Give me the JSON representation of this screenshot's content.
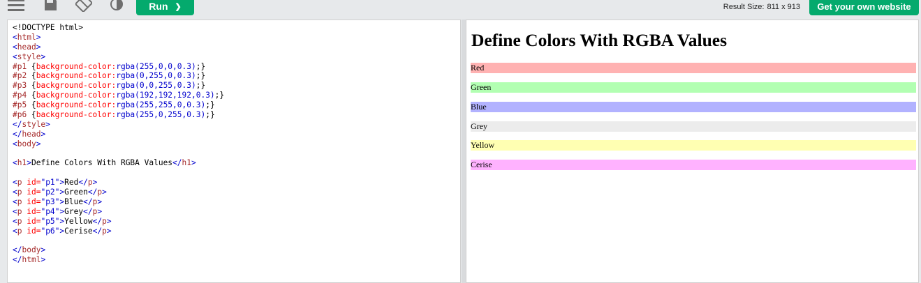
{
  "toolbar": {
    "run_label": "Run",
    "run_chevron": "❯",
    "result_size_label": "Result Size:",
    "result_size_value": "811 x 913",
    "get_site_label": "Get your own website"
  },
  "icons": {
    "menu": "menu-icon",
    "save": "save-icon",
    "orientation": "rotate-icon",
    "theme": "contrast-icon"
  },
  "editor": {
    "lines": [
      [
        [
          "t-doc",
          "<!DOCTYPE html>"
        ]
      ],
      [
        [
          "t-br",
          "<"
        ],
        [
          "t-tag",
          "html"
        ],
        [
          "t-br",
          ">"
        ]
      ],
      [
        [
          "t-br",
          "<"
        ],
        [
          "t-tag",
          "head"
        ],
        [
          "t-br",
          ">"
        ]
      ],
      [
        [
          "t-br",
          "<"
        ],
        [
          "t-tag",
          "style"
        ],
        [
          "t-br",
          ">"
        ]
      ],
      [
        [
          "t-sel",
          "#p1 "
        ],
        [
          "t-txt",
          "{"
        ],
        [
          "t-prop",
          "background-color:"
        ],
        [
          "t-val",
          "rgba(255,0,0,0.3)"
        ],
        [
          "t-txt",
          ";}"
        ]
      ],
      [
        [
          "t-sel",
          "#p2 "
        ],
        [
          "t-txt",
          "{"
        ],
        [
          "t-prop",
          "background-color:"
        ],
        [
          "t-val",
          "rgba(0,255,0,0.3)"
        ],
        [
          "t-txt",
          ";}"
        ]
      ],
      [
        [
          "t-sel",
          "#p3 "
        ],
        [
          "t-txt",
          "{"
        ],
        [
          "t-prop",
          "background-color:"
        ],
        [
          "t-val",
          "rgba(0,0,255,0.3)"
        ],
        [
          "t-txt",
          ";}"
        ]
      ],
      [
        [
          "t-sel",
          "#p4 "
        ],
        [
          "t-txt",
          "{"
        ],
        [
          "t-prop",
          "background-color:"
        ],
        [
          "t-val",
          "rgba(192,192,192,0.3)"
        ],
        [
          "t-txt",
          ";}"
        ]
      ],
      [
        [
          "t-sel",
          "#p5 "
        ],
        [
          "t-txt",
          "{"
        ],
        [
          "t-prop",
          "background-color:"
        ],
        [
          "t-val",
          "rgba(255,255,0,0.3)"
        ],
        [
          "t-txt",
          ";}"
        ]
      ],
      [
        [
          "t-sel",
          "#p6 "
        ],
        [
          "t-txt",
          "{"
        ],
        [
          "t-prop",
          "background-color:"
        ],
        [
          "t-val",
          "rgba(255,0,255,0.3)"
        ],
        [
          "t-txt",
          ";}"
        ]
      ],
      [
        [
          "t-br",
          "</"
        ],
        [
          "t-tag",
          "style"
        ],
        [
          "t-br",
          ">"
        ]
      ],
      [
        [
          "t-br",
          "</"
        ],
        [
          "t-tag",
          "head"
        ],
        [
          "t-br",
          ">"
        ]
      ],
      [
        [
          "t-br",
          "<"
        ],
        [
          "t-tag",
          "body"
        ],
        [
          "t-br",
          ">"
        ]
      ],
      [],
      [
        [
          "t-br",
          "<"
        ],
        [
          "t-tag",
          "h1"
        ],
        [
          "t-br",
          ">"
        ],
        [
          "t-txt",
          "Define Colors With RGBA Values"
        ],
        [
          "t-br",
          "</"
        ],
        [
          "t-tag",
          "h1"
        ],
        [
          "t-br",
          ">"
        ]
      ],
      [],
      [
        [
          "t-br",
          "<"
        ],
        [
          "t-tag",
          "p"
        ],
        [
          "t-attr",
          " id="
        ],
        [
          "t-str",
          "\"p1\""
        ],
        [
          "t-br",
          ">"
        ],
        [
          "t-txt",
          "Red"
        ],
        [
          "t-br",
          "</"
        ],
        [
          "t-tag",
          "p"
        ],
        [
          "t-br",
          ">"
        ]
      ],
      [
        [
          "t-br",
          "<"
        ],
        [
          "t-tag",
          "p"
        ],
        [
          "t-attr",
          " id="
        ],
        [
          "t-str",
          "\"p2\""
        ],
        [
          "t-br",
          ">"
        ],
        [
          "t-txt",
          "Green"
        ],
        [
          "t-br",
          "</"
        ],
        [
          "t-tag",
          "p"
        ],
        [
          "t-br",
          ">"
        ]
      ],
      [
        [
          "t-br",
          "<"
        ],
        [
          "t-tag",
          "p"
        ],
        [
          "t-attr",
          " id="
        ],
        [
          "t-str",
          "\"p3\""
        ],
        [
          "t-br",
          ">"
        ],
        [
          "t-txt",
          "Blue"
        ],
        [
          "t-br",
          "</"
        ],
        [
          "t-tag",
          "p"
        ],
        [
          "t-br",
          ">"
        ]
      ],
      [
        [
          "t-br",
          "<"
        ],
        [
          "t-tag",
          "p"
        ],
        [
          "t-attr",
          " id="
        ],
        [
          "t-str",
          "\"p4\""
        ],
        [
          "t-br",
          ">"
        ],
        [
          "t-txt",
          "Grey"
        ],
        [
          "t-br",
          "</"
        ],
        [
          "t-tag",
          "p"
        ],
        [
          "t-br",
          ">"
        ]
      ],
      [
        [
          "t-br",
          "<"
        ],
        [
          "t-tag",
          "p"
        ],
        [
          "t-attr",
          " id="
        ],
        [
          "t-str",
          "\"p5\""
        ],
        [
          "t-br",
          ">"
        ],
        [
          "t-txt",
          "Yellow"
        ],
        [
          "t-br",
          "</"
        ],
        [
          "t-tag",
          "p"
        ],
        [
          "t-br",
          ">"
        ]
      ],
      [
        [
          "t-br",
          "<"
        ],
        [
          "t-tag",
          "p"
        ],
        [
          "t-attr",
          " id="
        ],
        [
          "t-str",
          "\"p6\""
        ],
        [
          "t-br",
          ">"
        ],
        [
          "t-txt",
          "Cerise"
        ],
        [
          "t-br",
          "</"
        ],
        [
          "t-tag",
          "p"
        ],
        [
          "t-br",
          ">"
        ]
      ],
      [],
      [
        [
          "t-br",
          "</"
        ],
        [
          "t-tag",
          "body"
        ],
        [
          "t-br",
          ">"
        ]
      ],
      [
        [
          "t-br",
          "</"
        ],
        [
          "t-tag",
          "html"
        ],
        [
          "t-br",
          ">"
        ]
      ]
    ]
  },
  "result": {
    "heading": "Define Colors With RGBA Values",
    "paragraphs": [
      {
        "label": "Red",
        "color": "rgba(255,0,0,0.3)"
      },
      {
        "label": "Green",
        "color": "rgba(0,255,0,0.3)"
      },
      {
        "label": "Blue",
        "color": "rgba(0,0,255,0.3)"
      },
      {
        "label": "Grey",
        "color": "rgba(192,192,192,0.3)"
      },
      {
        "label": "Yellow",
        "color": "rgba(255,255,0,0.3)"
      },
      {
        "label": "Cerise",
        "color": "rgba(255,0,255,0.3)"
      }
    ]
  },
  "colors": {
    "accent": "#04aa6d",
    "toolbar_bg": "#e7e9eb"
  }
}
